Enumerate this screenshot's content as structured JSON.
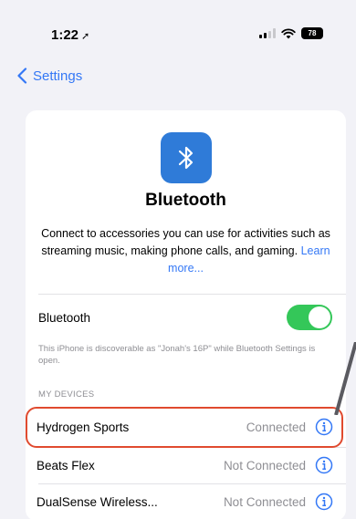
{
  "status_bar": {
    "time": "1:22",
    "arrow": "➚",
    "battery": "78"
  },
  "nav": {
    "back_label": "Settings"
  },
  "header": {
    "title": "Bluetooth",
    "description": "Connect to accessories you can use for activities such as streaming music, making phone calls, and gaming.",
    "learn_more": "Learn more..."
  },
  "bluetooth_toggle": {
    "label": "Bluetooth",
    "on": true
  },
  "footnote": "This iPhone is discoverable as \"Jonah's 16P\" while Bluetooth Settings is open.",
  "devices_section": {
    "header": "MY DEVICES",
    "items": [
      {
        "name": "Hydrogen Sports",
        "status": "Connected"
      },
      {
        "name": "Beats Flex",
        "status": "Not Connected"
      },
      {
        "name": "DualSense Wireless...",
        "status": "Not Connected"
      }
    ]
  },
  "colors": {
    "accent": "#3478f6",
    "toggle_on": "#34c759",
    "highlight": "#e04a2f",
    "bt_icon_bg": "#2f7bd8"
  }
}
